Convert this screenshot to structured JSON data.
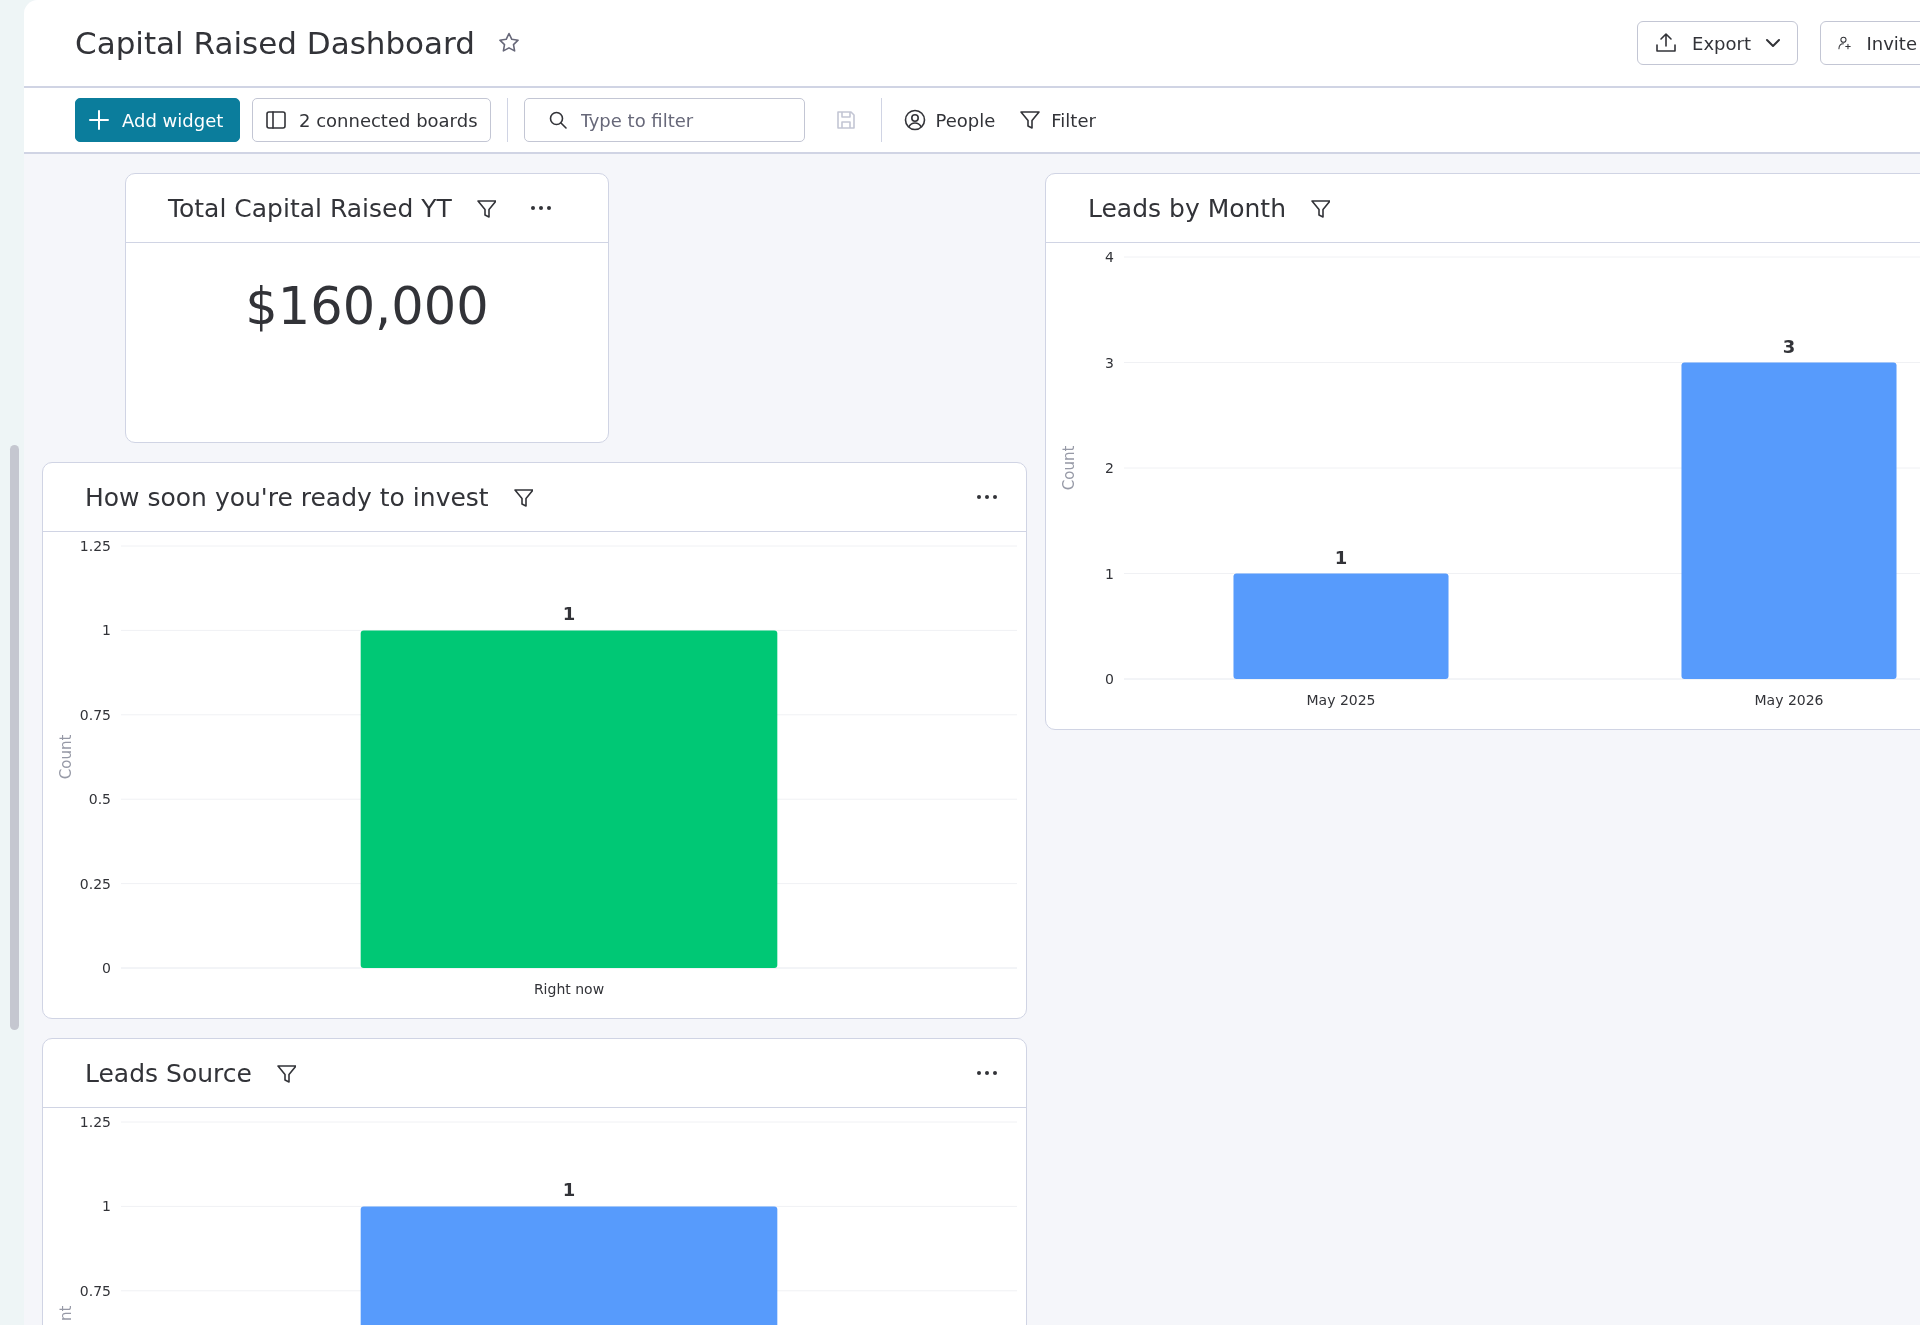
{
  "header": {
    "title": "Capital Raised Dashboard",
    "buttons": [
      {
        "label": "Export",
        "kind": "export"
      },
      {
        "label": "Invite",
        "kind": "invite"
      }
    ]
  },
  "toolbar": {
    "add_widget": "Add widget",
    "boards": "2 connected boards",
    "search": {
      "placeholder": "Type to filter"
    },
    "people": "People",
    "filter": "Filter"
  },
  "widgets": [
    {
      "kind": "number",
      "title": "Total Capital Raised YT",
      "menu": true,
      "value": "$160,000"
    },
    {
      "kind": "chart",
      "title": "Leads by Month",
      "menu": false,
      "chart_data": {
        "type": "bar",
        "ylabel": "Count",
        "categories": [
          "May 2025",
          "May 2026"
        ],
        "series": [
          {
            "color": "#579bfc",
            "values": [
              1,
              3
            ]
          }
        ],
        "ylim": [
          0,
          4
        ],
        "yticks": [
          0,
          1,
          2,
          3,
          4
        ],
        "grid": true,
        "data_labels": true
      }
    },
    {
      "kind": "chart",
      "title": "How soon you're ready to invest",
      "menu": true,
      "chart_data": {
        "type": "bar",
        "ylabel": "Count",
        "categories": [
          "Right now"
        ],
        "series": [
          {
            "color": "#00c875",
            "values": [
              1
            ]
          }
        ],
        "ylim": [
          0,
          1.25
        ],
        "yticks": [
          0,
          0.25,
          0.5,
          0.75,
          1,
          1.25
        ],
        "grid": true,
        "data_labels": true
      }
    },
    {
      "kind": "chart",
      "title": "Leads Source",
      "menu": true,
      "chart_data": {
        "type": "bar",
        "ylabel": "nt",
        "series": [
          {
            "color": "#579bfc",
            "values": [
              1
            ]
          }
        ],
        "ylim": [
          0,
          1.25
        ],
        "yticks": [
          0.75,
          1,
          1.25
        ],
        "grid": true,
        "data_labels": true
      }
    }
  ]
}
